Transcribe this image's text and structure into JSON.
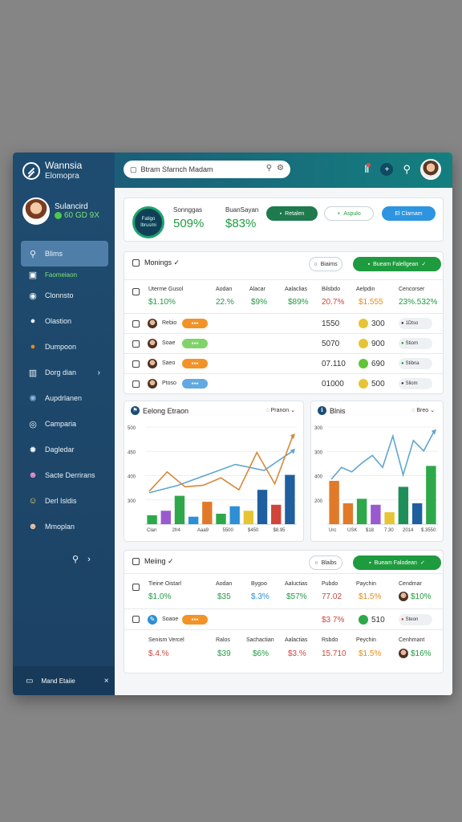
{
  "sidebar": {
    "brand": {
      "line1": "Wannsia",
      "line2": "Elomopra"
    },
    "profile": {
      "name": "Sulancird",
      "status": "60 GD 9X"
    },
    "items": [
      {
        "label": "Blims",
        "icon": "search-icon",
        "glyph": "⚲"
      },
      {
        "label": "Faomeiaon",
        "icon": "calendar-icon",
        "glyph": "▣"
      },
      {
        "label": "Clonnsto",
        "icon": "info-icon",
        "glyph": "◉"
      },
      {
        "label": "Olastion",
        "icon": "user-icon",
        "glyph": "●"
      },
      {
        "label": "Dumpoon",
        "icon": "orange-circle-icon",
        "glyph": "●"
      },
      {
        "label": "Dorg dian",
        "icon": "chart-icon",
        "glyph": "▥"
      },
      {
        "label": "Aupdrlanen",
        "icon": "gear-icon",
        "glyph": "✺"
      },
      {
        "label": "Camparia",
        "icon": "eye-icon",
        "glyph": "◎"
      },
      {
        "label": "Dagledar",
        "icon": "settings-icon",
        "glyph": "✹"
      },
      {
        "label": "Sacte Derrirans",
        "icon": "group-icon",
        "glyph": "☻"
      },
      {
        "label": "Derl Isldis",
        "icon": "people-icon",
        "glyph": "☺"
      },
      {
        "label": "Mmoplan",
        "icon": "avatar-icon",
        "glyph": "☻"
      }
    ],
    "footer": "Mand Etaiie"
  },
  "topbar": {
    "search_placeholder": "Btram Sfarnch Madam"
  },
  "stats": {
    "circle_l1": "Fatigo",
    "circle_l2": "Ibrusmi",
    "s1_label": "Sonnggas",
    "s1_value": "509%",
    "s2_label": "BuanSayan",
    "s2_value": "$83%",
    "btn1": "Retalen",
    "btn2": "Aspulo",
    "btn3": "El Clamam"
  },
  "table1": {
    "title": "Monings ✓",
    "btn_outline": "Biaims",
    "btn_green": "Bueam Falellgean",
    "headers": [
      "Uterme Gusol",
      "Aodan",
      "Alacar",
      "Aalaclias",
      "Bilsbdo",
      "Aelpdin",
      "Cencorser"
    ],
    "summary": [
      "$1.10%",
      "22.%",
      "$9%",
      "$89%",
      "20.7%",
      "$1.555",
      "23%.532%"
    ],
    "rows": [
      {
        "name": "Rebio",
        "num": "1550",
        "coin": "300",
        "chip": "1Dtso"
      },
      {
        "name": "Soae",
        "num": "5070",
        "coin": "900",
        "chip": "Stiom"
      },
      {
        "name": "Saeo",
        "num": "07.110",
        "coin": "690",
        "chip": "Stibna"
      },
      {
        "name": "Ptoso",
        "num": "01000",
        "coin": "500",
        "chip": "Sliom"
      }
    ]
  },
  "chart_left": {
    "title": "Eelong Etraon",
    "filter": "Pranon"
  },
  "chart_right": {
    "title": "Blnis",
    "filter": "Breo"
  },
  "table2": {
    "title": "Meiing ✓",
    "btn_outline": "Blaibs",
    "btn_green": "Bueam Falodean",
    "headers1": [
      "Tieine Oistarl",
      "Aodan",
      "Bygoo",
      "Aaluctias",
      "Pubdo",
      "Paychin",
      "Cendmar"
    ],
    "row1": [
      "$1.0%",
      "$35",
      "$.3%",
      "$57%",
      "77.02",
      "$1.5%",
      "$10%"
    ],
    "mid": {
      "name": "Soaoe",
      "val": "$3 7%",
      "coin": "510",
      "chip": "Steon"
    },
    "headers2": [
      "Senism Vercel",
      "Ralos",
      "Sachactian",
      "Aalactias",
      "Rsbdo",
      "Peychin",
      "Cenhmant"
    ],
    "row2": [
      "$.4.%",
      "$39",
      "$6%",
      "$3.%",
      "15.710",
      "$1.5%",
      "$16%"
    ]
  },
  "chart_data": [
    {
      "type": "bar",
      "title": "Eelong Etraon",
      "y_tick_labels": [
        "500",
        "450",
        "400",
        "300"
      ],
      "x_tick_labels": [
        "Clan",
        "2fr4",
        "Aaa9",
        "5500",
        "$450",
        "$8.95"
      ],
      "colors": [
        "#2ea84a",
        "#9b59d0",
        "#2ea84a",
        "#2d8fd5",
        "#e07a2a",
        "#2ea84a",
        "#2d8fd5",
        "#e6c534",
        "#1f5fa0",
        "#d0453a",
        "#1f5fa0"
      ],
      "values": [
        12,
        18,
        38,
        10,
        30,
        14,
        24,
        18,
        46,
        26,
        66
      ],
      "line_orange": [
        44,
        70,
        50,
        52,
        62,
        46,
        96,
        54,
        118
      ],
      "line_blue": [
        42,
        52,
        66,
        80,
        72,
        98
      ]
    },
    {
      "type": "bar",
      "title": "Blnis",
      "y_tick_labels": [
        "300",
        "300",
        "400",
        "200"
      ],
      "x_tick_labels": [
        "Urc",
        "USK",
        "$18",
        "7.30",
        "2014",
        "$.3550"
      ],
      "colors": [
        "#e07a2a",
        "#e07a2a",
        "#2ea84a",
        "#9b59d0",
        "#e6c534",
        "#1f8f5a",
        "#1f5fa0",
        "#2ea84a"
      ],
      "values": [
        58,
        28,
        34,
        26,
        16,
        50,
        28,
        78
      ],
      "line_blue": [
        60,
        76,
        70,
        82,
        92,
        76,
        118,
        66,
        112,
        98,
        124
      ]
    }
  ]
}
